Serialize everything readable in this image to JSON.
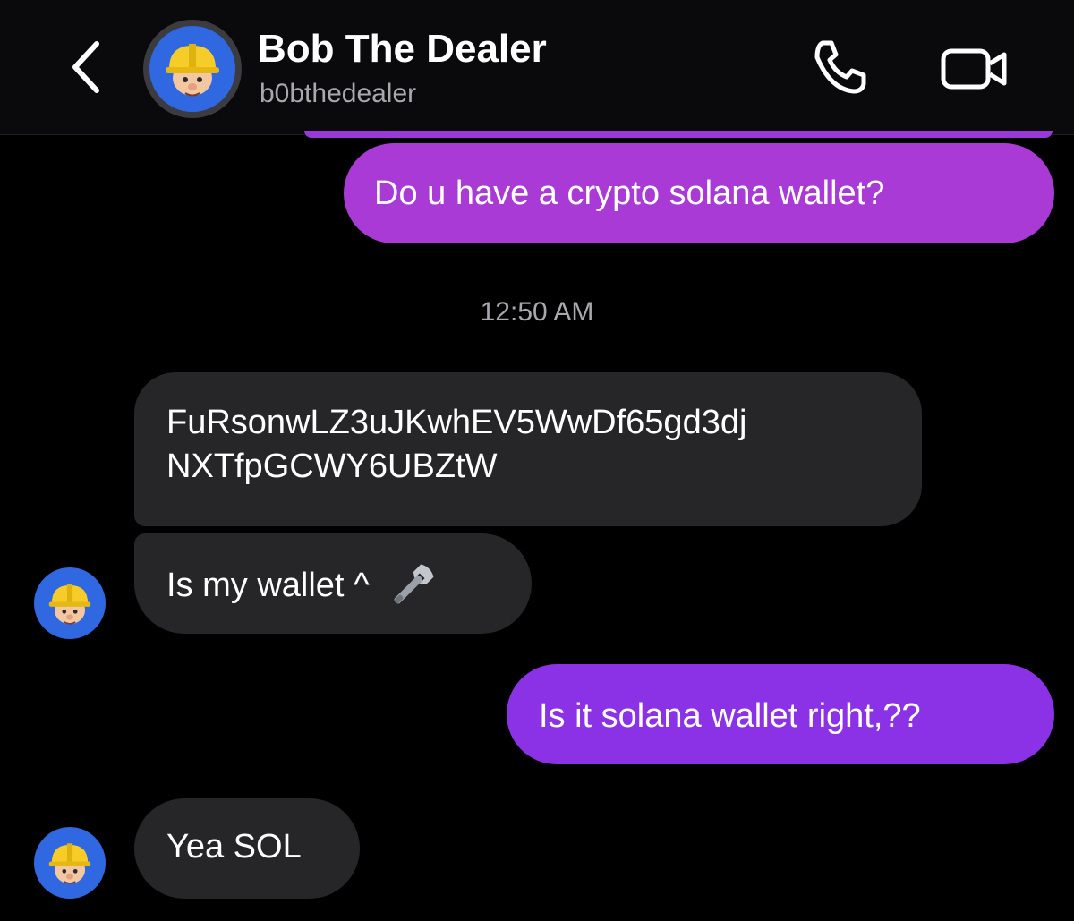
{
  "header": {
    "contact_name": "Bob The Dealer",
    "contact_handle": "b0bthedealer",
    "avatar_icon": "builder-character-avatar"
  },
  "icons": {
    "back": "chevron-left-icon",
    "call": "phone-icon",
    "video": "video-camera-icon",
    "wrench": "wrench-emoji"
  },
  "colors": {
    "background": "#000000",
    "outgoing_bubble_top": "#a93ad6",
    "outgoing_bubble_bottom": "#8b32e6",
    "incoming_bubble": "#262629",
    "avatar_background": "#2f68e0",
    "secondary_text": "#a8a8ad"
  },
  "messages": [
    {
      "direction": "outgoing",
      "text": "Do u have a crypto solana wallet?"
    },
    {
      "direction": "timestamp",
      "text": "12:50 AM"
    },
    {
      "direction": "incoming",
      "lines": [
        "FuRsonwLZ3uJKwhEV5WwDf65gd3dj",
        "NXTfpGCWY6UBZtW"
      ]
    },
    {
      "direction": "incoming",
      "text": "Is my wallet ^"
    },
    {
      "direction": "outgoing",
      "text": "Is it solana wallet right,??"
    },
    {
      "direction": "incoming",
      "text": "Yea SOL"
    }
  ]
}
